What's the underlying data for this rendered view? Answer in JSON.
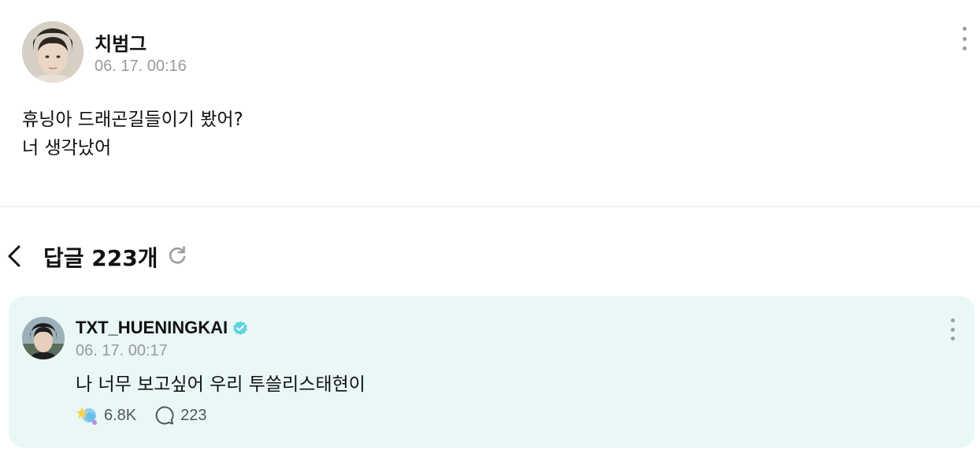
{
  "post": {
    "author": "치범그",
    "time": "06. 17. 00:16",
    "body_lines": [
      "휴닝아 드래곤길들이기 봤어?",
      "너 생각났어"
    ]
  },
  "replies": {
    "title": "답글 223개"
  },
  "reply": {
    "author": "TXT_HUENINGKAI",
    "verified": true,
    "time": "06. 17. 00:17",
    "body": "나 너무 보고싶어 우리 투쓸리스태현이",
    "reaction_count": "6.8K",
    "comment_count": "223"
  },
  "colors": {
    "reply_background": "#e9f8f6",
    "verified_badge": "#5fd3e0",
    "muted_text": "#9a9a9a"
  },
  "icons": {
    "more": "more-vertical-icon",
    "back": "chevron-left-icon",
    "refresh": "refresh-icon",
    "verified": "verified-badge-icon",
    "reaction": "star-reaction-icon",
    "comment": "comment-bubble-icon"
  }
}
